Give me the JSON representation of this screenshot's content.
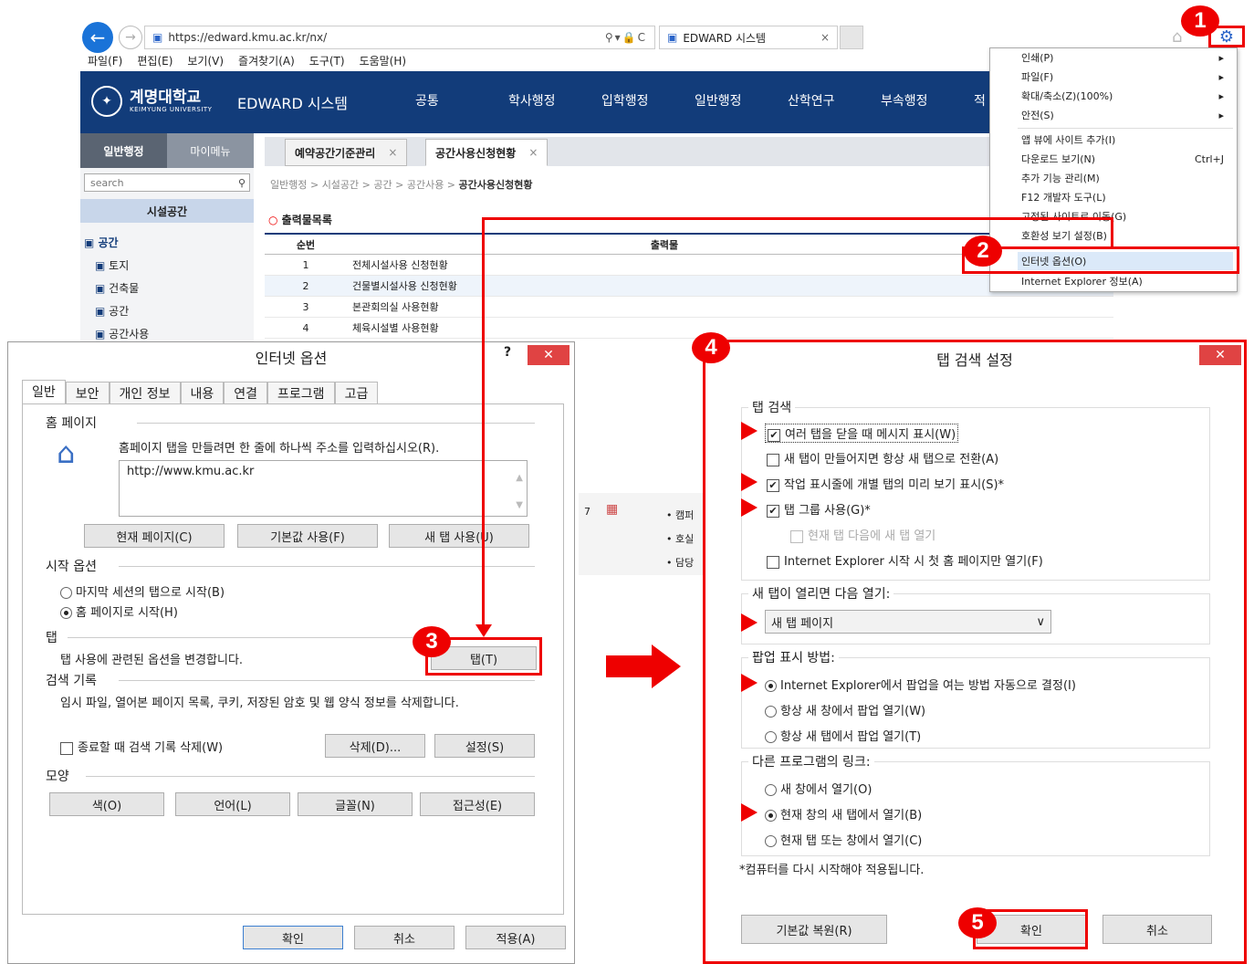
{
  "browser": {
    "url": "https://edward.kmu.ac.kr/nx/",
    "tab_title": "EDWARD 시스템",
    "tab_close": "×",
    "menu": [
      "파일(F)",
      "편집(E)",
      "보기(V)",
      "즐겨찾기(A)",
      "도구(T)",
      "도움말(H)"
    ]
  },
  "site": {
    "logo_name": "계명대학교",
    "logo_sub": "KEIMYUNG UNIVERSITY",
    "system_title": "EDWARD 시스템",
    "top_nav": [
      "공통",
      "학사행정",
      "입학행정",
      "일반행정",
      "산학연구",
      "부속행정"
    ],
    "top_nav_cut": "적",
    "left_tabs": [
      "일반행정",
      "마이메뉴"
    ],
    "search_placeholder": "search",
    "section": "시설공간",
    "tree": [
      "공간",
      "토지",
      "건축물",
      "공간",
      "공간사용"
    ],
    "content_tabs": [
      "예약공간기준관리",
      "공간사용신청현황"
    ],
    "breadcrumb": "일반행정 > 시설공간 > 공간 > 공간사용 >",
    "breadcrumb_current": "공간사용신청현황",
    "output_title": "출력물목록",
    "table_headers": [
      "순번",
      "출력물"
    ],
    "table_rows": [
      {
        "no": "1",
        "name": "전체시설사용 신청현황"
      },
      {
        "no": "2",
        "name": "건물별시설사용 신청현황"
      },
      {
        "no": "3",
        "name": "본관회의실 사용현황"
      },
      {
        "no": "4",
        "name": "체육시설별 사용현황"
      }
    ],
    "behind_fragments": [
      "• 캠퍼",
      "• 호실",
      "• 담당"
    ],
    "behind_date": "7"
  },
  "context_menu": {
    "items": [
      {
        "label": "인쇄(P)",
        "shortcut": "▸"
      },
      {
        "label": "파일(F)",
        "shortcut": "▸"
      },
      {
        "label": "확대/축소(Z)(100%)",
        "shortcut": "▸"
      },
      {
        "label": "안전(S)",
        "shortcut": "▸"
      },
      {
        "label": "앱 뷰에 사이트 추가(I)",
        "shortcut": ""
      },
      {
        "label": "다운로드 보기(N)",
        "shortcut": "Ctrl+J"
      },
      {
        "label": "추가 기능 관리(M)",
        "shortcut": ""
      },
      {
        "label": "F12 개발자 도구(L)",
        "shortcut": ""
      },
      {
        "label": "고정된 사이트로 이동(G)",
        "shortcut": ""
      },
      {
        "label": "호환성 보기 설정(B)",
        "shortcut": ""
      },
      {
        "label": "인터넷 옵션(O)",
        "shortcut": ""
      },
      {
        "label": "Internet Explorer 정보(A)",
        "shortcut": ""
      }
    ]
  },
  "internet_options": {
    "title": "인터넷 옵션",
    "help": "?",
    "close": "✕",
    "tabs": [
      "일반",
      "보안",
      "개인 정보",
      "내용",
      "연결",
      "프로그램",
      "고급"
    ],
    "home_section": "홈 페이지",
    "home_desc": "홈페이지 탭을 만들려면 한 줄에 하나씩 주소를 입력하십시오(R).",
    "home_url": "http://www.kmu.ac.kr",
    "home_buttons": [
      "현재 페이지(C)",
      "기본값 사용(F)",
      "새 탭 사용(U)"
    ],
    "start_section": "시작 옵션",
    "start_options": [
      "마지막 세션의 탭으로 시작(B)",
      "홈 페이지로 시작(H)"
    ],
    "tab_section": "탭",
    "tab_desc": "탭 사용에 관련된 옵션을 변경합니다.",
    "tab_button": "탭(T)",
    "history_section": "검색 기록",
    "history_desc": "임시 파일, 열어본 페이지 목록, 쿠키, 저장된 암호 및 웹 양식 정보를 삭제합니다.",
    "history_check": "종료할 때 검색 기록 삭제(W)",
    "history_buttons": [
      "삭제(D)...",
      "설정(S)"
    ],
    "appearance_section": "모양",
    "appearance_buttons": [
      "색(O)",
      "언어(L)",
      "글꼴(N)",
      "접근성(E)"
    ],
    "footer_buttons": [
      "확인",
      "취소",
      "적용(A)"
    ]
  },
  "tab_settings": {
    "title": "탭 검색 설정",
    "close": "✕",
    "group1": "탭 검색",
    "checks": [
      {
        "label": "여러 탭을 닫을 때 메시지 표시(W)",
        "checked": true,
        "disabled": false
      },
      {
        "label": "새 탭이 만들어지면 항상 새 탭으로 전환(A)",
        "checked": false,
        "disabled": false
      },
      {
        "label": "작업 표시줄에 개별 탭의 미리 보기 표시(S)*",
        "checked": true,
        "disabled": false
      },
      {
        "label": "탭 그룹 사용(G)*",
        "checked": true,
        "disabled": false
      },
      {
        "label": "현재 탭 다음에 새 탭 열기",
        "checked": false,
        "disabled": true
      },
      {
        "label": "Internet Explorer 시작 시 첫 홈 페이지만 열기(F)",
        "checked": false,
        "disabled": false
      }
    ],
    "group2": "새 탭이 열리면 다음 열기:",
    "newtab_select": "새 탭 페이지",
    "group3": "팝업 표시 방법:",
    "popup_options": [
      "Internet Explorer에서 팝업을 여는 방법 자동으로 결정(I)",
      "항상 새 창에서 팝업 열기(W)",
      "항상 새 탭에서 팝업 열기(T)"
    ],
    "group4": "다른 프로그램의 링크:",
    "link_options": [
      "새 창에서 열기(O)",
      "현재 창의 새 탭에서 열기(B)",
      "현재 탭 또는 창에서 열기(C)"
    ],
    "footnote": "*컴퓨터를 다시 시작해야 적용됩니다.",
    "buttons": [
      "기본값 복원(R)",
      "확인",
      "취소"
    ]
  },
  "annotations": {
    "badges": [
      "1",
      "2",
      "3",
      "4",
      "5"
    ],
    "accent": "#e00000"
  }
}
